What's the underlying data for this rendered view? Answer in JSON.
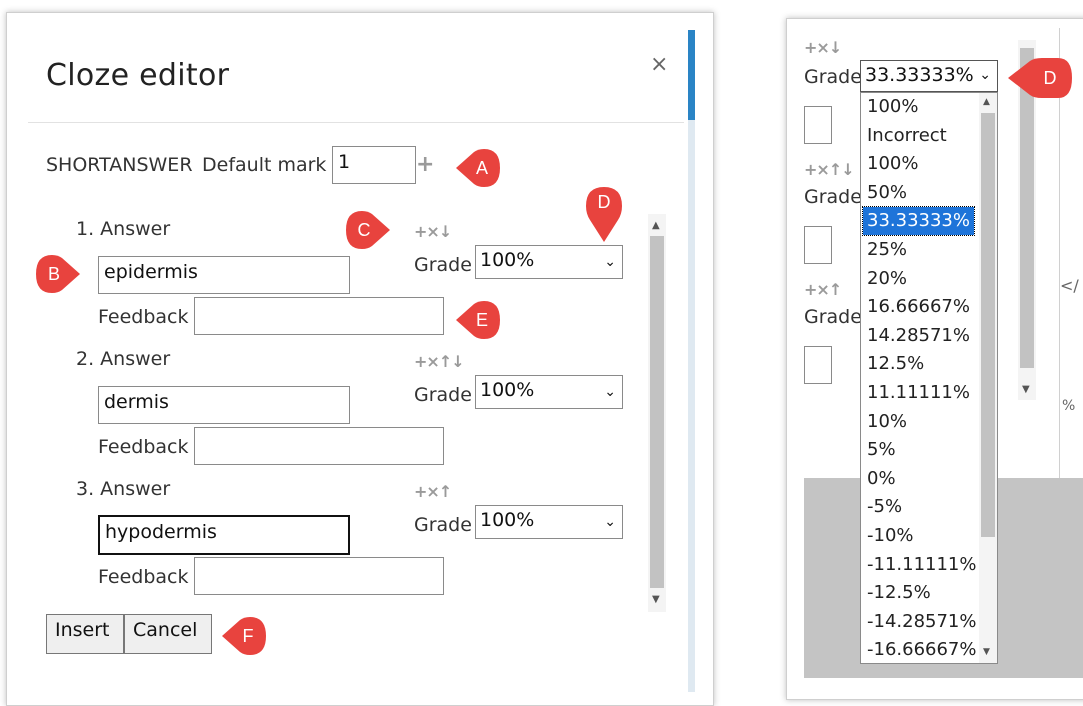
{
  "dialog": {
    "title": "Cloze editor",
    "close_symbol": "×",
    "type_label": "SHORTANSWER",
    "default_mark_label": "Default mark",
    "default_mark_value": "1",
    "plus_symbol": "+",
    "feedback_label": "Feedback",
    "grade_label": "Grade",
    "answers": [
      {
        "label": "1. Answer",
        "value": "epidermis",
        "grade": "100%",
        "tools": "+×↓",
        "feedback": ""
      },
      {
        "label": "2. Answer",
        "value": "dermis",
        "grade": "100%",
        "tools": "+×↑↓",
        "feedback": ""
      },
      {
        "label": "3. Answer",
        "value": "hypodermis",
        "grade": "100%",
        "tools": "+×↑",
        "feedback": ""
      }
    ],
    "buttons": {
      "insert": "Insert",
      "cancel": "Cancel"
    }
  },
  "callouts": {
    "a": "A",
    "b": "B",
    "c": "C",
    "d": "D",
    "e": "E",
    "f": "F"
  },
  "right_panel": {
    "tools": [
      "+×↓",
      "+×↑↓",
      "+×↑"
    ],
    "grade_label": "Grade",
    "selected_grade": "33.33333%",
    "partial_text_1": "</",
    "partial_text_2": "%",
    "grade_options": [
      "100%",
      "Incorrect",
      "100%",
      "50%",
      "33.33333%",
      "25%",
      "20%",
      "16.66667%",
      "14.28571%",
      "12.5%",
      "11.11111%",
      "10%",
      "5%",
      "0%",
      "-5%",
      "-10%",
      "-11.11111%",
      "-12.5%",
      "-14.28571%",
      "-16.66667%"
    ],
    "highlighted_option": "33.33333%"
  },
  "colors": {
    "callout": "#e8433e",
    "selection": "#1e74d9",
    "accent_bar": "#2a84c5"
  }
}
